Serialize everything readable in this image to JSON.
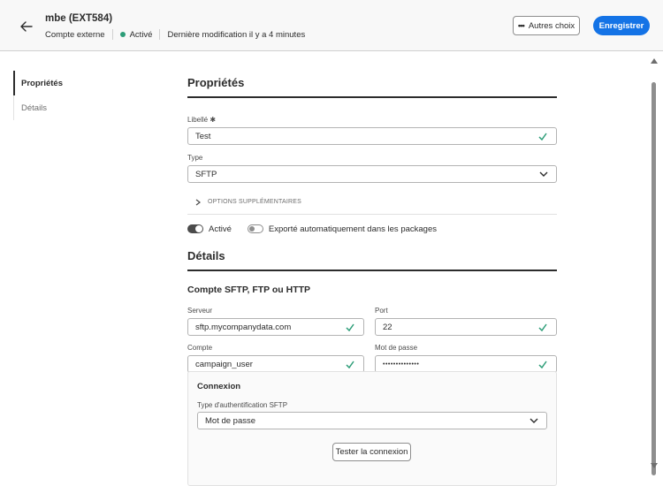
{
  "header": {
    "title": "mbe (EXT584)",
    "account_type": "Compte externe",
    "status": "Activé",
    "last_modified": "Dernière modification il y a 4 minutes",
    "more_button": "Autres choix",
    "save_button": "Enregistrer"
  },
  "sidebar": {
    "items": [
      {
        "label": "Propriétés"
      },
      {
        "label": "Détails"
      }
    ]
  },
  "properties": {
    "title": "Propriétés",
    "label_label": "Libellé",
    "label_value": "Test",
    "type_label": "Type",
    "type_value": "SFTP",
    "options_label": "OPTIONS SUPPLÉMENTAIRES",
    "active_label": "Activé",
    "export_label": "Exporté automatiquement dans les packages"
  },
  "details": {
    "title": "Détails",
    "subtitle": "Compte SFTP, FTP ou HTTP",
    "server_label": "Serveur",
    "server_value": "sftp.mycompanydata.com",
    "port_label": "Port",
    "port_value": "22",
    "account_label": "Compte",
    "account_value": "campaign_user",
    "password_label": "Mot de passe",
    "password_value": "••••••••••••••"
  },
  "connection": {
    "title": "Connexion",
    "auth_label": "Type d'authentification SFTP",
    "auth_value": "Mot de passe",
    "test_button": "Tester la connexion"
  },
  "colors": {
    "accent": "#1473e6",
    "success": "#2d9d78"
  }
}
